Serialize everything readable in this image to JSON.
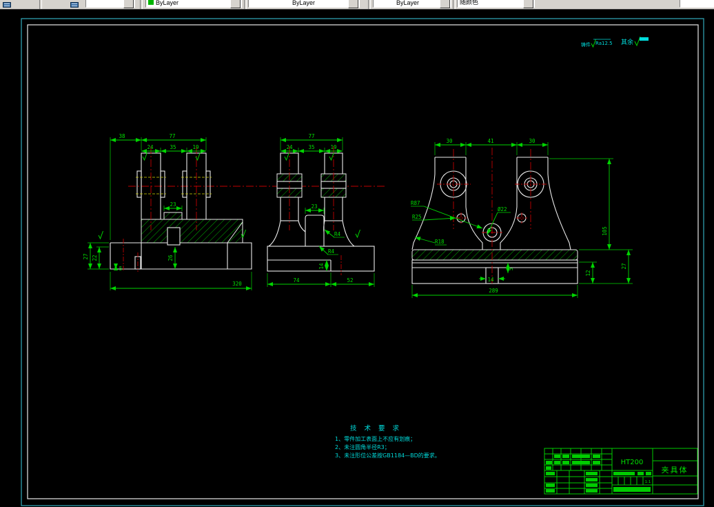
{
  "toolbar": {
    "layer_value": "",
    "color_value": "ByLayer",
    "linetype_value": "ByLayer",
    "lineweight_value": "ByLayer",
    "plotstyle_value": "随颜色"
  },
  "notes": {
    "casting_prefix": "铸件",
    "casting_roughness": "Ra12.5",
    "others_label": "其余"
  },
  "tech": {
    "title": "技 术 要 求",
    "item1": "1、零件加工表面上不应有划痕；",
    "item2": "2、未注圆角半径R3；",
    "item3": "3、未注形位公差按GB1184—BD的要求。"
  },
  "title_block": {
    "material": "HT200",
    "part_name": "夹具体",
    "scale": "1:1"
  },
  "front": {
    "d38": "38",
    "d77": "77",
    "d24": "24",
    "d35": "35",
    "d19": "19",
    "d23": "23",
    "d26": "26",
    "d27": "27",
    "d22": "22",
    "d5": "5",
    "d320": "320"
  },
  "section": {
    "d77": "77",
    "d24": "24",
    "d35": "35",
    "d19": "19",
    "d23": "23",
    "d74": "74",
    "d52": "52",
    "d14": "14",
    "r4a": "R4",
    "r4b": "R4"
  },
  "side": {
    "d30l": "30",
    "d41": "41",
    "d30r": "30",
    "d105": "105",
    "d27": "27",
    "d12": "12",
    "d289": "289",
    "d14": "14",
    "d5": "5",
    "r87": "R87",
    "r25": "R25",
    "r18": "R18",
    "dia22": "Ø22"
  }
}
